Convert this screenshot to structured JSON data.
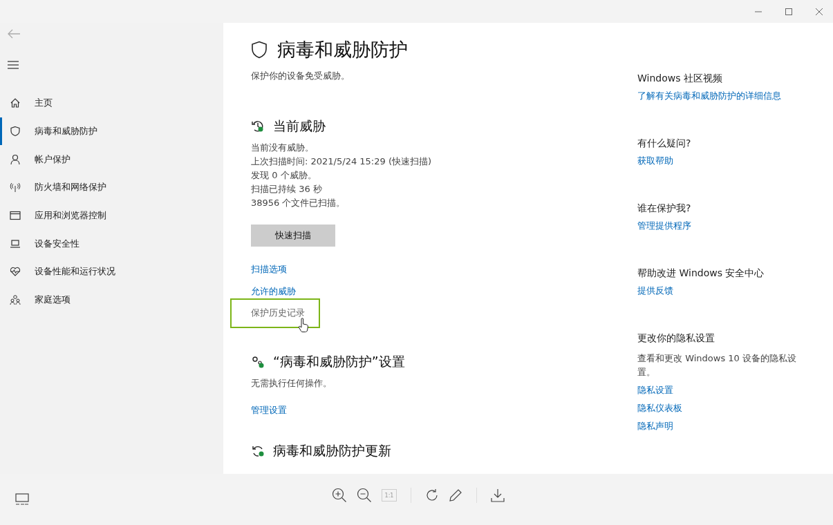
{
  "viewer_toolbar": {
    "zoom_label": "1:1"
  },
  "sidebar": {
    "items": [
      {
        "label": "主页",
        "selected": false
      },
      {
        "label": "病毒和威胁防护",
        "selected": true
      },
      {
        "label": "帐户保护",
        "selected": false
      },
      {
        "label": "防火墙和网络保护",
        "selected": false
      },
      {
        "label": "应用和浏览器控制",
        "selected": false
      },
      {
        "label": "设备安全性",
        "selected": false
      },
      {
        "label": "设备性能和运行状况",
        "selected": false
      },
      {
        "label": "家庭选项",
        "selected": false
      }
    ]
  },
  "page": {
    "title": "病毒和威胁防护",
    "subtitle": "保护你的设备免受威胁。",
    "sections": [
      {
        "heading": "当前威胁",
        "lines": [
          "当前没有威胁。",
          "上次扫描时间: 2021/5/24 15:29 (快速扫描)",
          "发现 0 个威胁。",
          "扫描已持续 36 秒",
          "38956 个文件已扫描。"
        ],
        "button": "快速扫描",
        "links": [
          {
            "label": "扫描选项",
            "focused": false
          },
          {
            "label": "允许的威胁",
            "focused": false
          },
          {
            "label": "保护历史记录",
            "focused": true
          }
        ]
      },
      {
        "heading": "“病毒和威胁防护”设置",
        "lines": [
          "无需执行任何操作。"
        ],
        "links": [
          {
            "label": "管理设置",
            "focused": false
          }
        ]
      },
      {
        "heading": "病毒和威胁防护更新"
      }
    ]
  },
  "aside": [
    {
      "heading": "Windows 社区视频",
      "links": [
        "了解有关病毒和威胁防护的详细信息"
      ]
    },
    {
      "heading": "有什么疑问?",
      "links": [
        "获取帮助"
      ]
    },
    {
      "heading": "谁在保护我?",
      "links": [
        "管理提供程序"
      ]
    },
    {
      "heading": "帮助改进 Windows 安全中心",
      "links": [
        "提供反馈"
      ]
    },
    {
      "heading": "更改你的隐私设置",
      "text": "查看和更改 Windows 10 设备的隐私设置。",
      "links": [
        "隐私设置",
        "隐私仪表板",
        "隐私声明"
      ]
    }
  ]
}
